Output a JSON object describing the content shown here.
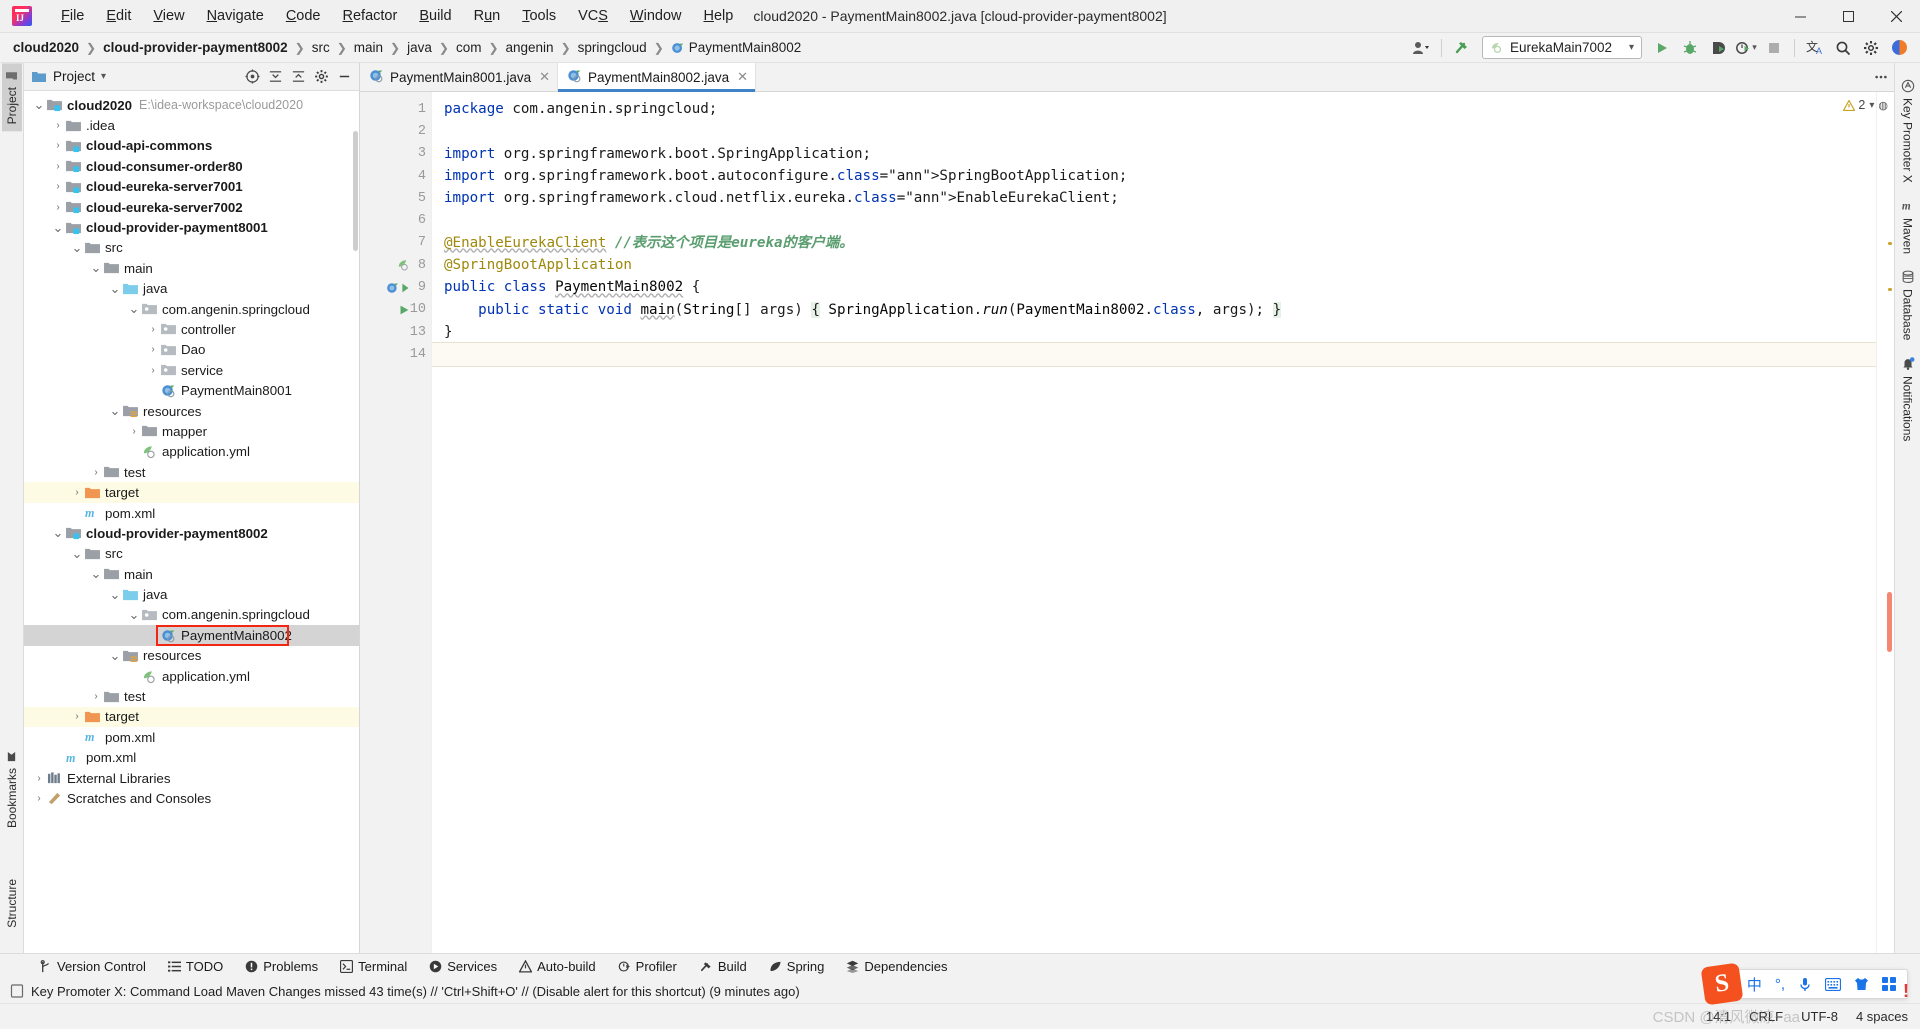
{
  "window": {
    "title": "cloud2020 - PaymentMain8002.java [cloud-provider-payment8002]",
    "minimize": "–",
    "maximize": "□",
    "close": "✕"
  },
  "menubar": [
    "File",
    "Edit",
    "View",
    "Navigate",
    "Code",
    "Refactor",
    "Build",
    "Run",
    "Tools",
    "VCS",
    "Window",
    "Help"
  ],
  "breadcrumbs": [
    {
      "label": "cloud2020",
      "bold": true
    },
    {
      "label": "cloud-provider-payment8002",
      "bold": true
    },
    {
      "label": "src",
      "bold": false
    },
    {
      "label": "main",
      "bold": false
    },
    {
      "label": "java",
      "bold": false
    },
    {
      "label": "com",
      "bold": false
    },
    {
      "label": "angenin",
      "bold": false
    },
    {
      "label": "springcloud",
      "bold": false
    },
    {
      "label": "PaymentMain8002",
      "bold": false,
      "icon": "java-class-icon"
    }
  ],
  "toolbar": {
    "account_label": "user-account",
    "build_label": "build-hammer",
    "run_config": "EurekaMain7002",
    "run": "run-button",
    "debug": "debug-button",
    "run_coverage": "run-with-coverage-button",
    "profiler": "profiler-button",
    "stop": "stop-button",
    "translate": "translate-button",
    "search": "search-everywhere-button",
    "settings": "settings-button",
    "help_ai": "ai-assistant-button"
  },
  "left_strip": {
    "project_tab": "Project",
    "bookmarks_tab": "Bookmarks",
    "structure_tab": "Structure"
  },
  "project_panel": {
    "title": "Project",
    "dropdown": "▾",
    "actions": [
      "select-opened-file",
      "collapse-all",
      "expand-all",
      "settings",
      "hide"
    ],
    "tree": [
      {
        "depth": 0,
        "twist": "v",
        "icon": "module",
        "label": "cloud2020",
        "bold": true,
        "path": "E:\\idea-workspace\\cloud2020"
      },
      {
        "depth": 1,
        "twist": ">",
        "icon": "folder",
        "label": ".idea",
        "bold": false
      },
      {
        "depth": 1,
        "twist": ">",
        "icon": "module",
        "label": "cloud-api-commons",
        "bold": true
      },
      {
        "depth": 1,
        "twist": ">",
        "icon": "module",
        "label": "cloud-consumer-order80",
        "bold": true
      },
      {
        "depth": 1,
        "twist": ">",
        "icon": "module",
        "label": "cloud-eureka-server7001",
        "bold": true
      },
      {
        "depth": 1,
        "twist": ">",
        "icon": "module",
        "label": "cloud-eureka-server7002",
        "bold": true
      },
      {
        "depth": 1,
        "twist": "v",
        "icon": "module",
        "label": "cloud-provider-payment8001",
        "bold": true
      },
      {
        "depth": 2,
        "twist": "v",
        "icon": "folder",
        "label": "src",
        "bold": false
      },
      {
        "depth": 3,
        "twist": "v",
        "icon": "folder",
        "label": "main",
        "bold": false
      },
      {
        "depth": 4,
        "twist": "v",
        "icon": "source-folder",
        "label": "java",
        "bold": false
      },
      {
        "depth": 5,
        "twist": "v",
        "icon": "package",
        "label": "com.angenin.springcloud",
        "bold": false
      },
      {
        "depth": 6,
        "twist": ">",
        "icon": "package",
        "label": "controller",
        "bold": false
      },
      {
        "depth": 6,
        "twist": ">",
        "icon": "package",
        "label": "Dao",
        "bold": false
      },
      {
        "depth": 6,
        "twist": ">",
        "icon": "package",
        "label": "service",
        "bold": false
      },
      {
        "depth": 6,
        "twist": "",
        "icon": "spring-class",
        "label": "PaymentMain8001",
        "bold": false
      },
      {
        "depth": 4,
        "twist": "v",
        "icon": "resource-folder",
        "label": "resources",
        "bold": false
      },
      {
        "depth": 5,
        "twist": ">",
        "icon": "folder",
        "label": "mapper",
        "bold": false
      },
      {
        "depth": 5,
        "twist": "",
        "icon": "spring-yml",
        "label": "application.yml",
        "bold": false
      },
      {
        "depth": 3,
        "twist": ">",
        "icon": "folder",
        "label": "test",
        "bold": false
      },
      {
        "depth": 2,
        "twist": ">",
        "icon": "target-folder",
        "label": "target",
        "bold": false,
        "highlight": true
      },
      {
        "depth": 2,
        "twist": "",
        "icon": "maven",
        "label": "pom.xml",
        "bold": false
      },
      {
        "depth": 1,
        "twist": "v",
        "icon": "module",
        "label": "cloud-provider-payment8002",
        "bold": true
      },
      {
        "depth": 2,
        "twist": "v",
        "icon": "folder",
        "label": "src",
        "bold": false
      },
      {
        "depth": 3,
        "twist": "v",
        "icon": "folder",
        "label": "main",
        "bold": false
      },
      {
        "depth": 4,
        "twist": "v",
        "icon": "source-folder",
        "label": "java",
        "bold": false
      },
      {
        "depth": 5,
        "twist": "v",
        "icon": "package",
        "label": "com.angenin.springcloud",
        "bold": false
      },
      {
        "depth": 6,
        "twist": "",
        "icon": "spring-class",
        "label": "PaymentMain8002",
        "bold": false,
        "selected": true,
        "redbox": true
      },
      {
        "depth": 4,
        "twist": "v",
        "icon": "resource-folder",
        "label": "resources",
        "bold": false
      },
      {
        "depth": 5,
        "twist": "",
        "icon": "spring-yml",
        "label": "application.yml",
        "bold": false
      },
      {
        "depth": 3,
        "twist": ">",
        "icon": "folder",
        "label": "test",
        "bold": false
      },
      {
        "depth": 2,
        "twist": ">",
        "icon": "target-folder",
        "label": "target",
        "bold": false,
        "highlight": true
      },
      {
        "depth": 2,
        "twist": "",
        "icon": "maven",
        "label": "pom.xml",
        "bold": false
      },
      {
        "depth": 1,
        "twist": "",
        "icon": "maven",
        "label": "pom.xml",
        "bold": false
      },
      {
        "depth": 0,
        "twist": ">",
        "icon": "libraries",
        "label": "External Libraries",
        "bold": false
      },
      {
        "depth": 0,
        "twist": ">",
        "icon": "scratches",
        "label": "Scratches and Consoles",
        "bold": false
      }
    ]
  },
  "editor": {
    "tabs": [
      {
        "label": "PaymentMain8001.java",
        "active": false,
        "close": "✕"
      },
      {
        "label": "PaymentMain8002.java",
        "active": true,
        "close": "✕"
      }
    ],
    "warn_count": "2",
    "lines": [
      {
        "num": "1",
        "gutter": "",
        "fold": "",
        "text": "package com.angenin.springcloud;"
      },
      {
        "num": "2",
        "gutter": "",
        "fold": "",
        "text": ""
      },
      {
        "num": "3",
        "gutter": "",
        "fold": "-",
        "text": "import org.springframework.boot.SpringApplication;"
      },
      {
        "num": "4",
        "gutter": "",
        "fold": "",
        "text": "import org.springframework.boot.autoconfigure.SpringBootApplication;"
      },
      {
        "num": "5",
        "gutter": "",
        "fold": "",
        "text": "import org.springframework.cloud.netflix.eureka.EnableEurekaClient;"
      },
      {
        "num": "6",
        "gutter": "",
        "fold": "",
        "text": ""
      },
      {
        "num": "7",
        "gutter": "",
        "fold": "-",
        "text": "@EnableEurekaClient //表示这个项目是eureka的客户端。"
      },
      {
        "num": "8",
        "gutter": "spring-bean",
        "fold": "-",
        "text": "@SpringBootApplication"
      },
      {
        "num": "9",
        "gutter": "spring-run",
        "fold": "",
        "text": "public class PaymentMain8002 {"
      },
      {
        "num": "10",
        "gutter": "run-method",
        "fold": "+",
        "text": "    public static void main(String[] args) { SpringApplication.run(PaymentMain8002.class, args); }"
      },
      {
        "num": "13",
        "gutter": "",
        "fold": "",
        "text": "}"
      },
      {
        "num": "14",
        "gutter": "",
        "fold": "",
        "text": ""
      }
    ],
    "code_comment_zh": "//表示这个项目是eureka的客户端。"
  },
  "right_strip": [
    {
      "label": "Key Promoter X",
      "icon": "key-promoter-icon"
    },
    {
      "label": "Maven",
      "icon": "maven-icon"
    },
    {
      "label": "Database",
      "icon": "database-icon"
    },
    {
      "label": "Notifications",
      "icon": "notifications-bell-icon"
    }
  ],
  "tool_windows": [
    {
      "label": "Version Control",
      "icon": "branch-icon"
    },
    {
      "label": "TODO",
      "icon": "todo-list-icon"
    },
    {
      "label": "Problems",
      "icon": "problems-icon"
    },
    {
      "label": "Terminal",
      "icon": "terminal-icon"
    },
    {
      "label": "Services",
      "icon": "services-icon"
    },
    {
      "label": "Auto-build",
      "icon": "auto-build-icon"
    },
    {
      "label": "Profiler",
      "icon": "profiler-icon"
    },
    {
      "label": "Build",
      "icon": "build-hammer-icon"
    },
    {
      "label": "Spring",
      "icon": "spring-leaf-icon"
    },
    {
      "label": "Dependencies",
      "icon": "dependencies-icon"
    }
  ],
  "status": {
    "message": "Key Promoter X: Command Load Maven Changes missed 43 time(s) // 'Ctrl+Shift+O' // (Disable alert for this shortcut) (9 minutes ago)",
    "caret": "14:1",
    "line_separator": "CRLF",
    "encoding": "UTF-8",
    "indent": "4 spaces",
    "watermark": "CSDN @清风微凉~aa"
  },
  "ime": {
    "logo": "S",
    "mode": "中",
    "punct": "°,",
    "voice": "voice-input-icon",
    "keyboard": "soft-keyboard-icon",
    "skin": "skin-icon",
    "apps": "toolbox-icon"
  },
  "colors": {
    "accent": "#4083c9",
    "keyword": "#0033b3",
    "annotation": "#9e880d",
    "comment": "#5a9e6f",
    "selection": "#d4d4d4",
    "redbox": "#f22613",
    "green_run": "#59a869",
    "target_highlight": "#fdfbe3"
  }
}
